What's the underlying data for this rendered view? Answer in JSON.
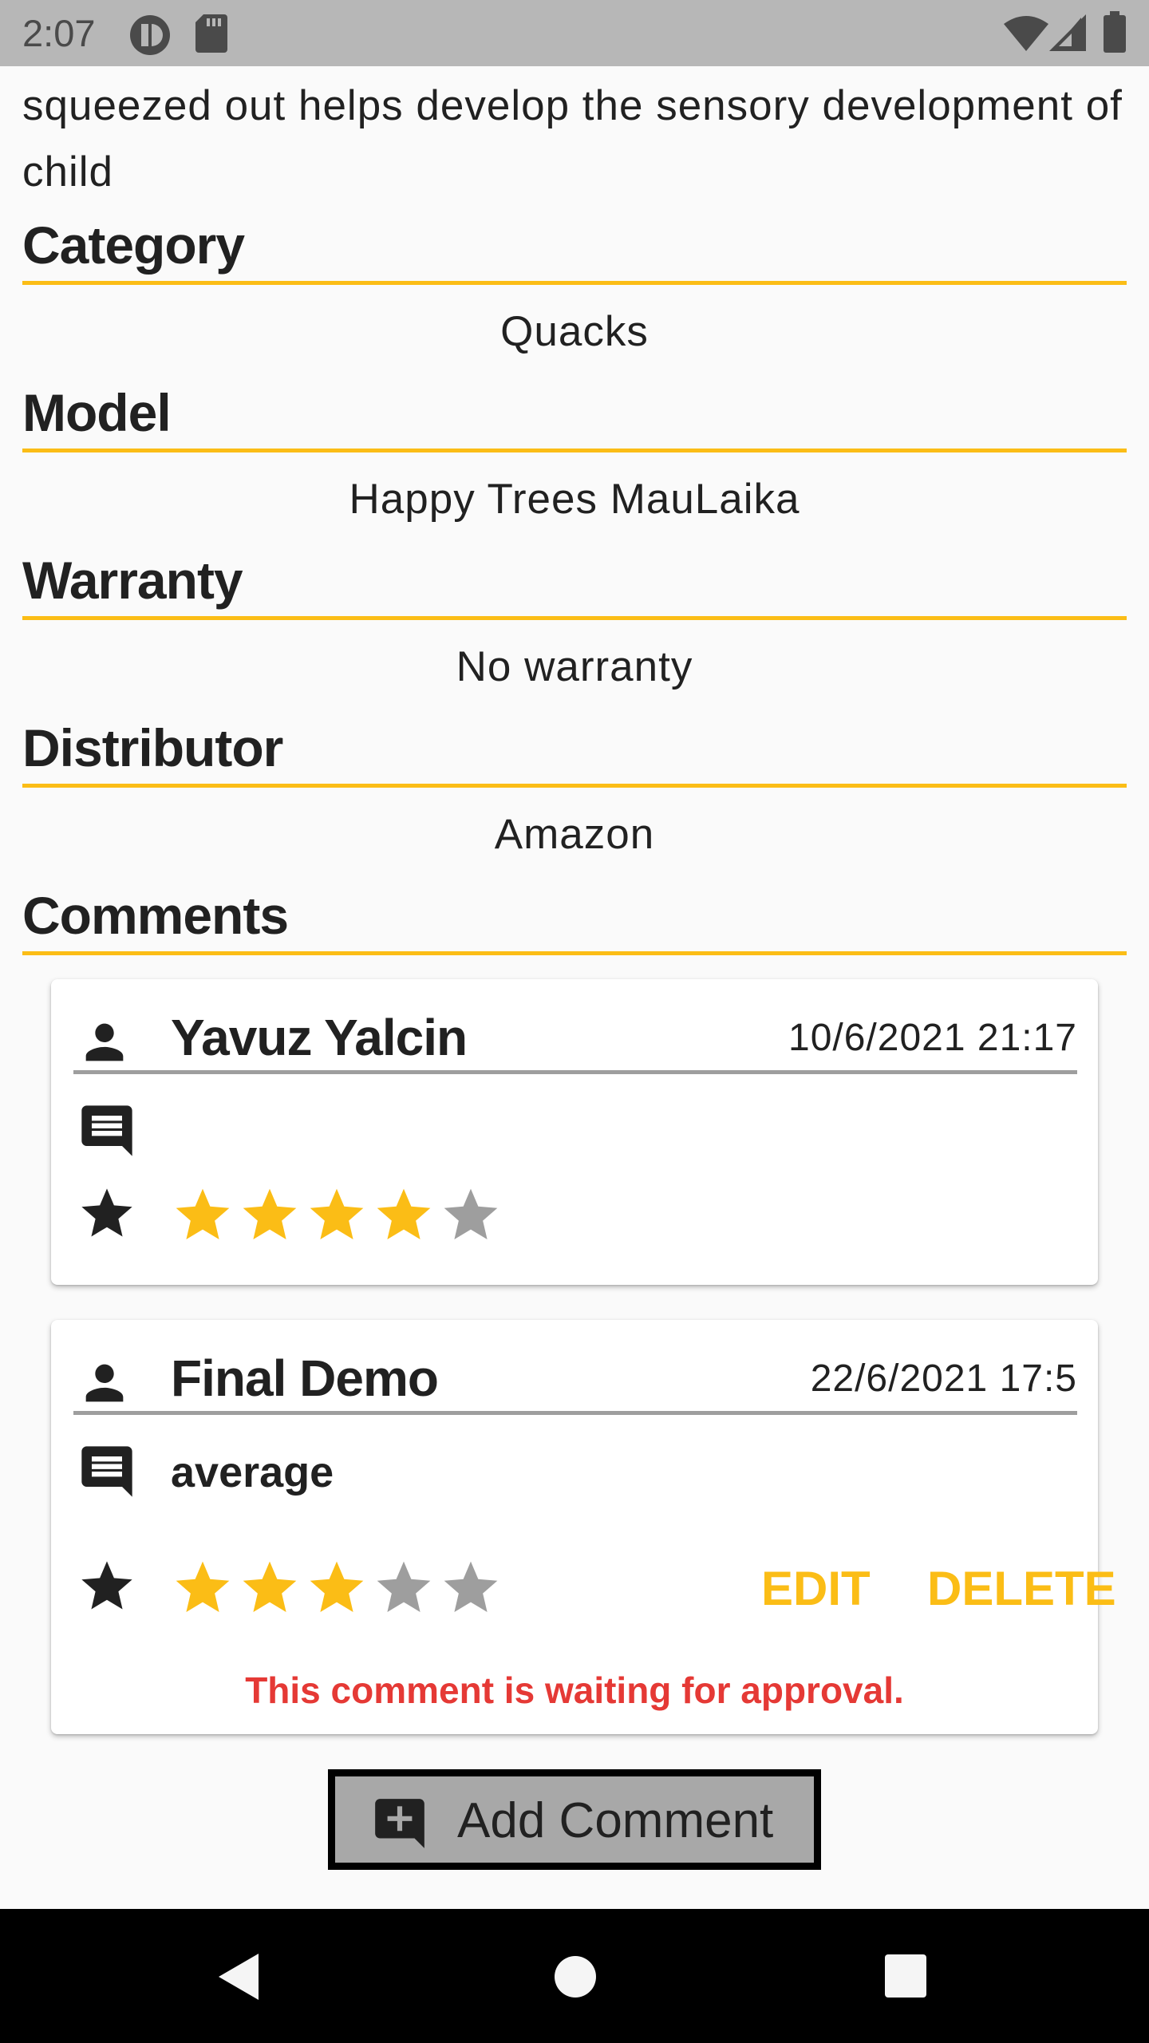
{
  "status_bar": {
    "time": "2:07",
    "icons": [
      "app-icon",
      "sd-card-icon",
      "wifi-icon",
      "signal-icon",
      "battery-icon"
    ]
  },
  "description_tail": "squeezed out helps develop the sensory development of child",
  "sections": {
    "category": {
      "title": "Category",
      "value": "Quacks"
    },
    "model": {
      "title": "Model",
      "value": "Happy Trees MauLaika"
    },
    "warranty": {
      "title": "Warranty",
      "value": "No warranty"
    },
    "distributor": {
      "title": "Distributor",
      "value": "Amazon"
    },
    "comments": {
      "title": "Comments"
    }
  },
  "comments": [
    {
      "author": "Yavuz Yalcin",
      "date": "10/6/2021 21:17",
      "text": "",
      "rating": 4,
      "max_rating": 5
    },
    {
      "author": "Final Demo",
      "date": "22/6/2021 17:5",
      "text": "average",
      "rating": 3,
      "max_rating": 5,
      "edit_label": "EDIT",
      "delete_label": "DELETE",
      "approval_notice": "This comment is waiting for approval."
    }
  ],
  "add_comment_label": "Add Comment",
  "colors": {
    "accent": "#fbbd16",
    "star_filled": "#fbbd16",
    "star_empty": "#9e9e9e",
    "warning": "#e53935",
    "status_bar": "#b7b7b7"
  },
  "nav": {
    "icons": [
      "back-icon",
      "home-icon",
      "recents-icon"
    ]
  }
}
